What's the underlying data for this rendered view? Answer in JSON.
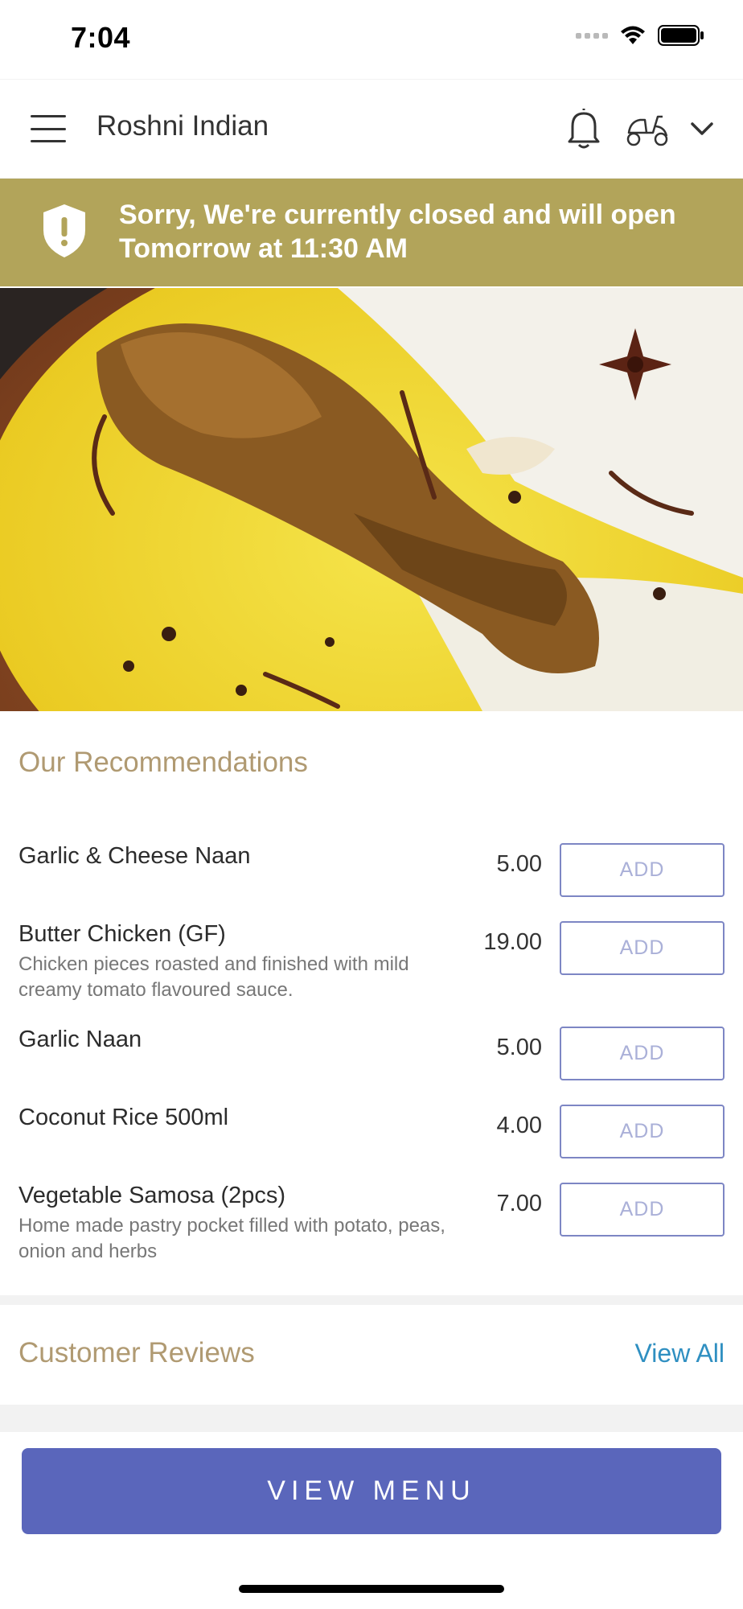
{
  "status_bar": {
    "time": "7:04"
  },
  "header": {
    "title": "Roshni Indian",
    "icons": [
      "menu-icon",
      "bell-icon",
      "scooter-icon",
      "chevron-down-icon"
    ]
  },
  "banner": {
    "message": "Sorry, We're currently closed and will open Tomorrow at 11:30 AM",
    "color": "#b2a45a"
  },
  "hero": {
    "description_icon": "food-photo"
  },
  "recommendations": {
    "title": "Our Recommendations",
    "add_label": "ADD",
    "items": [
      {
        "name": "Garlic & Cheese Naan",
        "description": "",
        "price": "5.00"
      },
      {
        "name": "Butter Chicken (GF)",
        "description": "Chicken pieces roasted and finished with mild creamy tomato flavoured sauce.",
        "price": "19.00"
      },
      {
        "name": "Garlic Naan",
        "description": "",
        "price": "5.00"
      },
      {
        "name": "Coconut Rice 500ml",
        "description": "",
        "price": "4.00"
      },
      {
        "name": "Vegetable Samosa (2pcs)",
        "description": "Home made pastry pocket filled with potato, peas, onion and herbs",
        "price": "7.00"
      }
    ]
  },
  "reviews": {
    "title": "Customer Reviews",
    "view_all": "View All"
  },
  "footer": {
    "view_menu": "VIEW MENU"
  },
  "colors": {
    "accent": "#5a66bb",
    "section_title": "#b09a72",
    "link": "#2f8fc1"
  }
}
